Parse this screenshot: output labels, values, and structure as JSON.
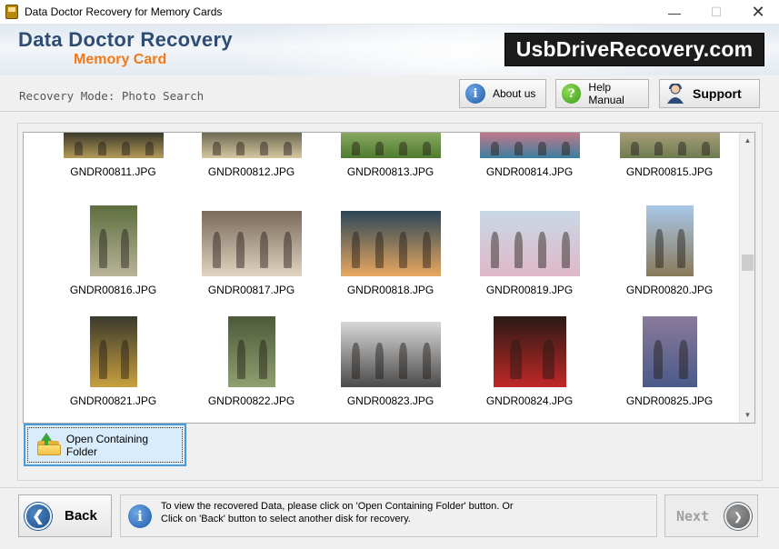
{
  "window": {
    "title": "Data Doctor Recovery for Memory Cards",
    "minimize": "—",
    "maximize": "☐",
    "close": "✕"
  },
  "header": {
    "brand_title": "Data Doctor Recovery",
    "brand_subtitle": "Memory Card",
    "site_logo": "UsbDriveRecovery.com"
  },
  "mode": {
    "label": "Recovery Mode: Photo Search"
  },
  "toolbar": {
    "about_label": "About us",
    "help_label": "Help Manual",
    "support_label": "Support"
  },
  "files": [
    {
      "name": "GNDR00811.JPG",
      "colors": [
        "#3b3a2c",
        "#b39a55"
      ]
    },
    {
      "name": "GNDR00812.JPG",
      "colors": [
        "#6e6a52",
        "#d6c8a0"
      ]
    },
    {
      "name": "GNDR00813.JPG",
      "colors": [
        "#88a860",
        "#4f7a2f"
      ]
    },
    {
      "name": "GNDR00814.JPG",
      "colors": [
        "#c07a8a",
        "#3a7ea0"
      ]
    },
    {
      "name": "GNDR00815.JPG",
      "colors": [
        "#a89c78",
        "#6c7c50"
      ]
    },
    {
      "name": "GNDR00816.JPG",
      "colors": [
        "#5e6e3e",
        "#b8b49a"
      ]
    },
    {
      "name": "GNDR00817.JPG",
      "colors": [
        "#7a6a5a",
        "#e0d4c0"
      ]
    },
    {
      "name": "GNDR00818.JPG",
      "colors": [
        "#2c4658",
        "#e8a860"
      ]
    },
    {
      "name": "GNDR00819.JPG",
      "colors": [
        "#c9d8e6",
        "#e0b8c8"
      ]
    },
    {
      "name": "GNDR00820.JPG",
      "colors": [
        "#a8c8e8",
        "#8a7a5a"
      ]
    },
    {
      "name": "GNDR00821.JPG",
      "colors": [
        "#3a3a2c",
        "#c8a040"
      ]
    },
    {
      "name": "GNDR00822.JPG",
      "colors": [
        "#4c5a3a",
        "#90a070"
      ]
    },
    {
      "name": "GNDR00823.JPG",
      "colors": [
        "#d8d8d8",
        "#4a4a4a"
      ]
    },
    {
      "name": "GNDR00824.JPG",
      "colors": [
        "#2a1a14",
        "#c02828"
      ]
    },
    {
      "name": "GNDR00825.JPG",
      "colors": [
        "#8a7a9a",
        "#4a5a8a"
      ]
    }
  ],
  "actions": {
    "open_folder_label": "Open Containing Folder"
  },
  "footer": {
    "back_label": "Back",
    "next_label": "Next",
    "info_line1": "To view the recovered Data, please click on 'Open Containing Folder' button. Or",
    "info_line2": "Click on 'Back' button to select another disk for recovery."
  }
}
